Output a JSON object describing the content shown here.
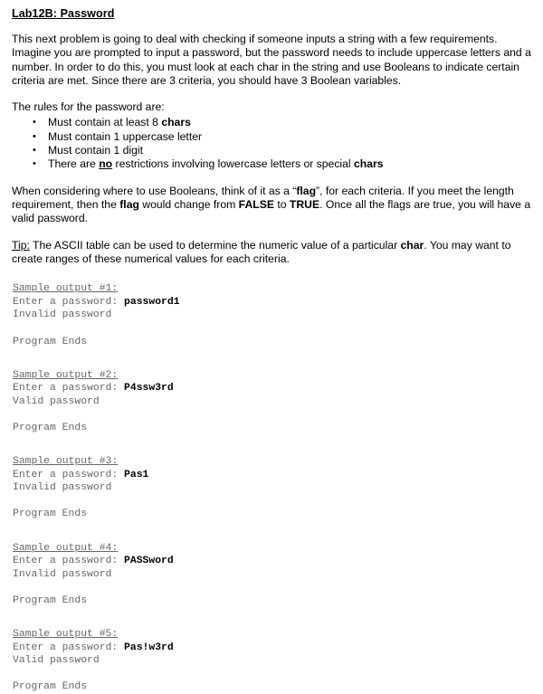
{
  "document": {
    "title": "Lab12B: Password",
    "intro_paragraph": {
      "text": "This next problem is going to deal with checking if someone inputs a string with a few requirements. Imagine you are prompted to input a password, but the password needs to include uppercase letters and a number. In order to do this, you must look at each char in the string and use Booleans to indicate certain criteria are met. Since there are 3 criteria, you should have 3 Boolean variables."
    },
    "rules_heading": "The rules for the password are:",
    "rules": [
      {
        "bullet": "•",
        "prefix": "Must contain at least 8 ",
        "bold": "chars",
        "suffix": ""
      },
      {
        "bullet": "•",
        "prefix": "Must contain 1 uppercase letter",
        "bold": "",
        "suffix": ""
      },
      {
        "bullet": "•",
        "prefix": "Must contain 1 digit",
        "bold": "",
        "suffix": ""
      },
      {
        "bullet": "•",
        "prefix": "There are ",
        "bold": "no",
        "suffix": " restrictions involving lowercase letters or special ",
        "suffix_bold": "chars"
      }
    ],
    "flag_paragraph": {
      "part1": "When considering where to use Booleans, think of it as a “",
      "flag1": "flag",
      "part2": "”, for each criteria. If you meet the length requirement, then the ",
      "flag2": "flag",
      "part3": " would change from ",
      "false_word": "FALSE",
      "part4": " to ",
      "true_word": "TRUE",
      "part5": ". Once all the flags are true, you will have a valid password."
    },
    "tip_paragraph": {
      "label": "Tip:",
      "part1": " The ASCII table can be used to determine the numeric value of a particular ",
      "char_word": "char",
      "part2": ". You may want to create ranges of these numerical values for each criteria."
    },
    "samples": [
      {
        "heading": "Sample output #1:",
        "prompt": "Enter a password: ",
        "input": "password1",
        "result": "Invalid password",
        "end": "Program Ends"
      },
      {
        "heading": "Sample output #2:",
        "prompt": "Enter a password: ",
        "input": "P4ssw3rd",
        "result": "Valid password",
        "end": "Program Ends"
      },
      {
        "heading": "Sample output #3:",
        "prompt": "Enter a password: ",
        "input": "Pas1",
        "result": "Invalid password",
        "end": "Program Ends"
      },
      {
        "heading": "Sample output #4:",
        "prompt": "Enter a password: ",
        "input": "PASSword",
        "result": "Invalid password",
        "end": "Program Ends"
      },
      {
        "heading": "Sample output #5:",
        "prompt": "Enter a password: ",
        "input": "Pas!w3rd",
        "result": "Valid password",
        "end": "Program Ends"
      }
    ],
    "colors": {
      "text": "#000000",
      "console_text": "#666666",
      "background": "#ffffff"
    }
  }
}
